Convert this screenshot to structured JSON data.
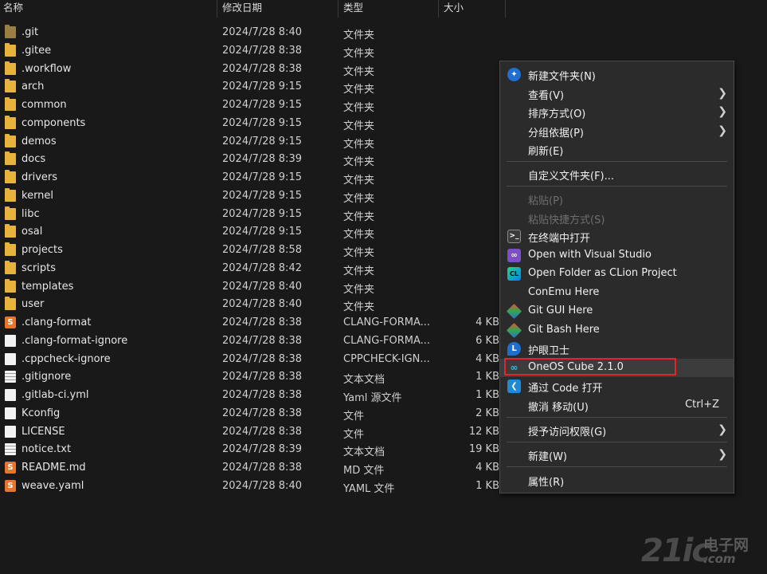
{
  "columns": {
    "name": "名称",
    "date": "修改日期",
    "type": "类型",
    "size": "大小"
  },
  "files": [
    {
      "name": ".git",
      "date": "2024/7/28 8:40",
      "type": "文件夹",
      "size": "",
      "icon": "folder-git-icon"
    },
    {
      "name": ".gitee",
      "date": "2024/7/28 8:38",
      "type": "文件夹",
      "size": "",
      "icon": "folder-icon"
    },
    {
      "name": ".workflow",
      "date": "2024/7/28 8:38",
      "type": "文件夹",
      "size": "",
      "icon": "folder-icon"
    },
    {
      "name": "arch",
      "date": "2024/7/28 9:15",
      "type": "文件夹",
      "size": "",
      "icon": "folder-icon"
    },
    {
      "name": "common",
      "date": "2024/7/28 9:15",
      "type": "文件夹",
      "size": "",
      "icon": "folder-icon"
    },
    {
      "name": "components",
      "date": "2024/7/28 9:15",
      "type": "文件夹",
      "size": "",
      "icon": "folder-icon"
    },
    {
      "name": "demos",
      "date": "2024/7/28 9:15",
      "type": "文件夹",
      "size": "",
      "icon": "folder-icon"
    },
    {
      "name": "docs",
      "date": "2024/7/28 8:39",
      "type": "文件夹",
      "size": "",
      "icon": "folder-icon"
    },
    {
      "name": "drivers",
      "date": "2024/7/28 9:15",
      "type": "文件夹",
      "size": "",
      "icon": "folder-icon"
    },
    {
      "name": "kernel",
      "date": "2024/7/28 9:15",
      "type": "文件夹",
      "size": "",
      "icon": "folder-icon"
    },
    {
      "name": "libc",
      "date": "2024/7/28 9:15",
      "type": "文件夹",
      "size": "",
      "icon": "folder-icon"
    },
    {
      "name": "osal",
      "date": "2024/7/28 9:15",
      "type": "文件夹",
      "size": "",
      "icon": "folder-icon"
    },
    {
      "name": "projects",
      "date": "2024/7/28 8:58",
      "type": "文件夹",
      "size": "",
      "icon": "folder-icon"
    },
    {
      "name": "scripts",
      "date": "2024/7/28 8:42",
      "type": "文件夹",
      "size": "",
      "icon": "folder-icon"
    },
    {
      "name": "templates",
      "date": "2024/7/28 8:40",
      "type": "文件夹",
      "size": "",
      "icon": "folder-icon"
    },
    {
      "name": "user",
      "date": "2024/7/28 8:40",
      "type": "文件夹",
      "size": "",
      "icon": "folder-icon"
    },
    {
      "name": ".clang-format",
      "date": "2024/7/28 8:38",
      "type": "CLANG-FORMA...",
      "size": "4 KB",
      "icon": "sublime-file-icon"
    },
    {
      "name": ".clang-format-ignore",
      "date": "2024/7/28 8:38",
      "type": "CLANG-FORMA...",
      "size": "6 KB",
      "icon": "file-icon"
    },
    {
      "name": ".cppcheck-ignore",
      "date": "2024/7/28 8:38",
      "type": "CPPCHECK-IGN...",
      "size": "4 KB",
      "icon": "file-icon"
    },
    {
      "name": ".gitignore",
      "date": "2024/7/28 8:38",
      "type": "文本文档",
      "size": "1 KB",
      "icon": "text-file-icon"
    },
    {
      "name": ".gitlab-ci.yml",
      "date": "2024/7/28 8:38",
      "type": "Yaml 源文件",
      "size": "1 KB",
      "icon": "yaml-file-icon"
    },
    {
      "name": "Kconfig",
      "date": "2024/7/28 8:38",
      "type": "文件",
      "size": "2 KB",
      "icon": "file-icon"
    },
    {
      "name": "LICENSE",
      "date": "2024/7/28 8:38",
      "type": "文件",
      "size": "12 KB",
      "icon": "file-icon"
    },
    {
      "name": "notice.txt",
      "date": "2024/7/28 8:39",
      "type": "文本文档",
      "size": "19 KB",
      "icon": "text-file-icon"
    },
    {
      "name": "README.md",
      "date": "2024/7/28 8:38",
      "type": "MD 文件",
      "size": "4 KB",
      "icon": "sublime-file-icon"
    },
    {
      "name": "weave.yaml",
      "date": "2024/7/28 8:40",
      "type": "YAML 文件",
      "size": "1 KB",
      "icon": "sublime-file-icon"
    }
  ],
  "context_menu": {
    "new_folder": "新建文件夹(N)",
    "view": "查看(V)",
    "sort_by": "排序方式(O)",
    "group_by": "分组依据(P)",
    "refresh": "刷新(E)",
    "customize_folder": "自定义文件夹(F)...",
    "paste": "粘贴(P)",
    "paste_shortcut": "粘贴快捷方式(S)",
    "open_in_terminal": "在终端中打开",
    "open_with_vs": "Open with Visual Studio",
    "open_clion": "Open Folder as CLion Project",
    "conemu": "ConEmu Here",
    "git_gui": "Git GUI Here",
    "git_bash": "Git Bash Here",
    "eye_guard": "护眼卫士",
    "oneos_cube": "OneOS  Cube  2.1.0",
    "open_vscode": "通过 Code 打开",
    "undo_move": "撤消 移动(U)",
    "undo_shortcut": "Ctrl+Z",
    "grant_access": "授予访问权限(G)",
    "new": "新建(W)",
    "properties": "属性(R)"
  },
  "watermark": {
    "brand": "21ic",
    "cn": "电子网",
    "url": ".com"
  },
  "colors": {
    "highlight_border": "#e0262b",
    "folder": "#e8b33d"
  }
}
